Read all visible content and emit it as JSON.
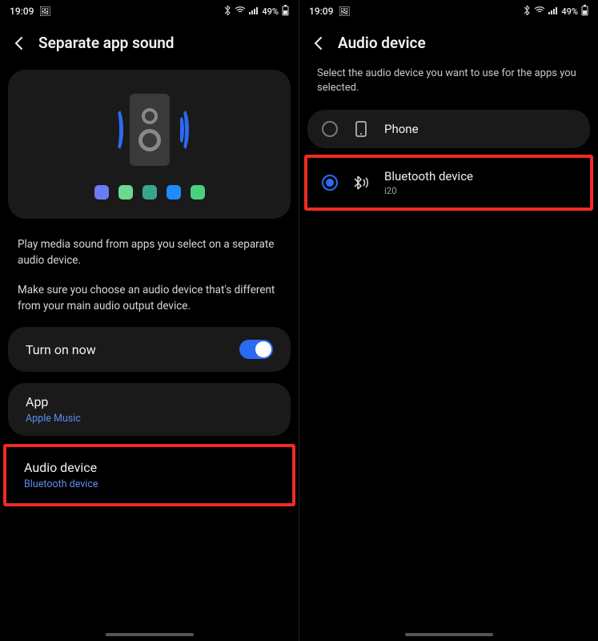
{
  "status": {
    "time": "19:09",
    "battery": "49%",
    "signal_icon": "signal",
    "wifi_icon": "wifi",
    "bt_icon": "bluetooth",
    "img_icon": "image"
  },
  "left": {
    "title": "Separate app sound",
    "dot_colors": [
      "#6a7bf5",
      "#6bd98e",
      "#3aa58f",
      "#1f8bff",
      "#4bcf7d"
    ],
    "desc1": "Play media sound from apps you select on a separate audio device.",
    "desc2": "Make sure you choose an audio device that's different from your main audio output device.",
    "toggle_label": "Turn on now",
    "toggle_on": true,
    "app_row": {
      "title": "App",
      "value": "Apple Music"
    },
    "audio_row": {
      "title": "Audio device",
      "value": "Bluetooth device"
    }
  },
  "right": {
    "title": "Audio device",
    "subhead": "Select the audio device you want to use for the apps you selected.",
    "options": [
      {
        "label": "Phone",
        "icon": "phone",
        "selected": false
      },
      {
        "label": "Bluetooth device",
        "sub": "i20",
        "icon": "bluetooth-audio",
        "selected": true
      }
    ]
  }
}
